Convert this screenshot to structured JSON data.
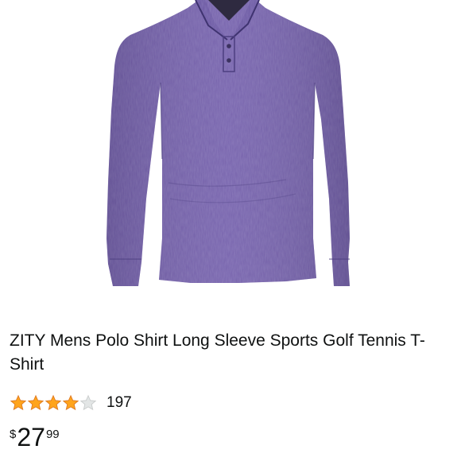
{
  "product": {
    "image_name": "purple-long-sleeve-polo-shirt",
    "shirt_color": "#6f5aa8",
    "title": "ZITY Mens Polo Shirt Long Sleeve Sports Golf Tennis T-Shirt",
    "rating": {
      "stars": 4.5,
      "max": 5,
      "star_color": "#ffa41c",
      "empty_color": "#d5d9d9",
      "review_count": "197"
    },
    "price": {
      "symbol": "$",
      "whole": "27",
      "fraction": "99"
    }
  }
}
